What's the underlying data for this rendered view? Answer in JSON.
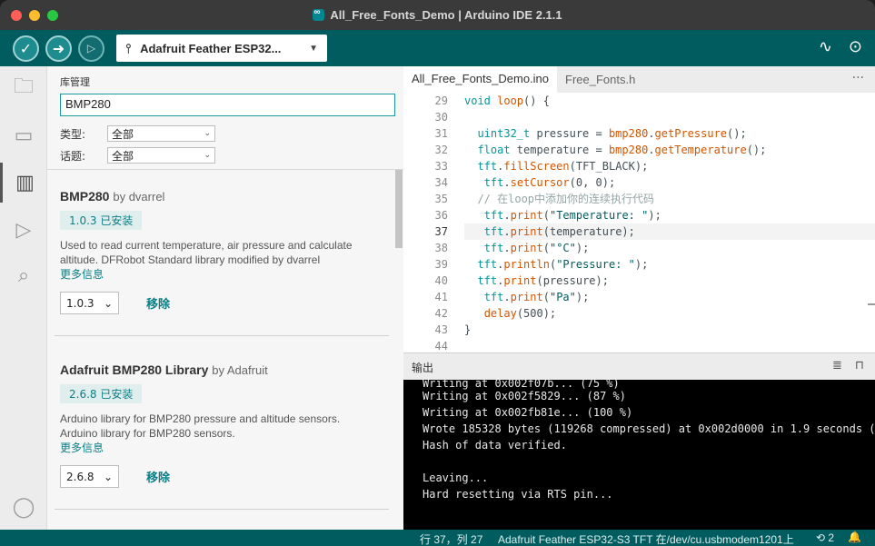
{
  "window": {
    "title": "All_Free_Fonts_Demo | Arduino IDE 2.1.1"
  },
  "toolbar": {
    "board": "Adafruit Feather ESP32...",
    "verify_icon": "checkmark-icon",
    "upload_icon": "arrow-right-icon",
    "debug_icon": "debug-icon"
  },
  "library": {
    "title": "库管理",
    "search_value": "BMP280",
    "type_label": "类型:",
    "type_value": "全部",
    "topic_label": "话题:",
    "topic_value": "全部",
    "items": [
      {
        "name": "BMP280",
        "by": "by dvarrel",
        "installed": "1.0.3 已安装",
        "desc1": "Used to read current temperature, air pressure and calculate",
        "desc2": "altitude. DFRobot Standard library modified by dvarrel",
        "more": "更多信息",
        "version": "1.0.3",
        "remove": "移除"
      },
      {
        "name": "Adafruit BMP280 Library",
        "by": "by Adafruit",
        "installed": "2.6.8 已安装",
        "desc1": "Arduino library for BMP280 pressure and altitude sensors.",
        "desc2": "Arduino library for BMP280 sensors.",
        "more": "更多信息",
        "version": "2.6.8",
        "remove": "移除"
      }
    ]
  },
  "editor": {
    "tabs": [
      "All_Free_Fonts_Demo.ino",
      "Free_Fonts.h"
    ],
    "more": "···",
    "line_numbers": [
      "29",
      "30",
      "31",
      "32",
      "33",
      "34",
      "35",
      "36",
      "37",
      "38",
      "39",
      "40",
      "41",
      "42",
      "43",
      "44"
    ],
    "current_line": "37"
  },
  "output": {
    "title": "输出",
    "lines": [
      "Writing at 0x002f07b... (75 %)",
      "Writing at 0x002f5829... (87 %)",
      "Writing at 0x002fb81e... (100 %)",
      "Wrote 185328 bytes (119268 compressed) at 0x002d0000 in 1.9 seconds (",
      "Hash of data verified.",
      "",
      "Leaving...",
      "Hard resetting via RTS pin..."
    ]
  },
  "status": {
    "position": "行 37，列 27",
    "board": "Adafruit Feather ESP32-S3 TFT 在/dev/cu.usbmodem1201上",
    "notifications": "2"
  }
}
